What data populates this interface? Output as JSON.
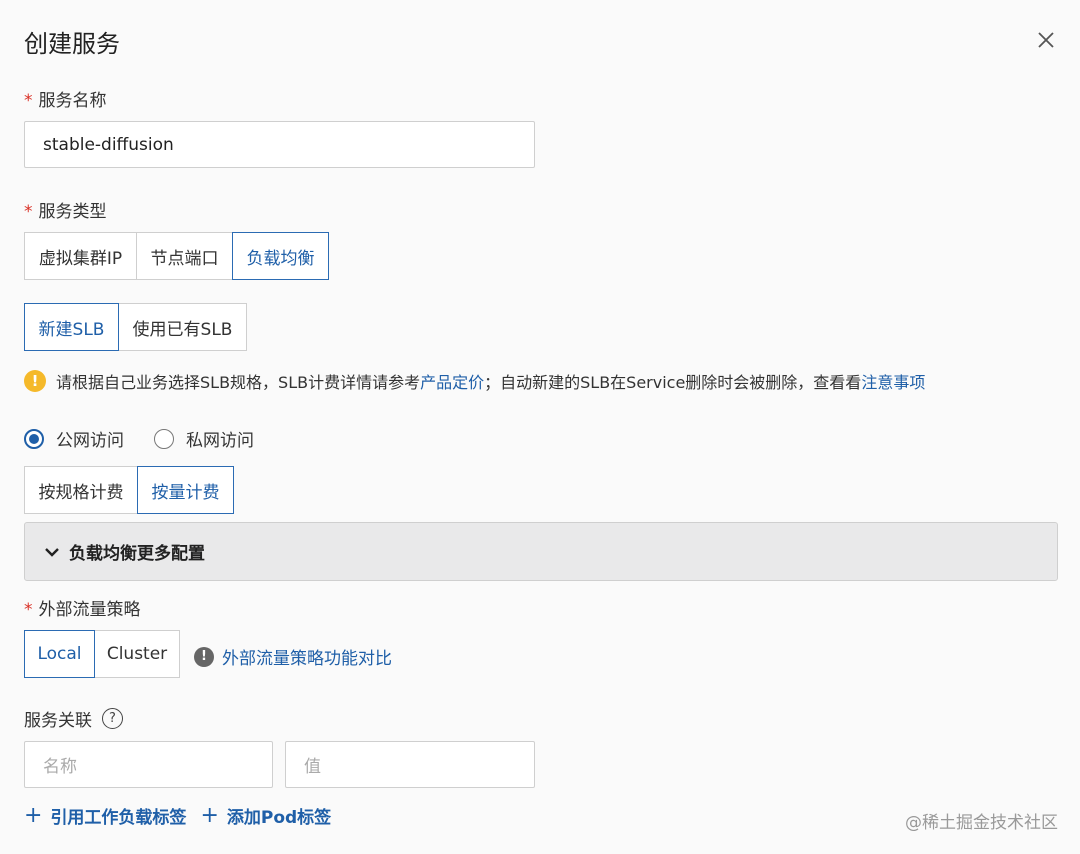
{
  "dialog": {
    "title": "创建服务",
    "close_icon": "close-icon"
  },
  "service_name": {
    "label": "服务名称",
    "required": "*",
    "value": "stable-diffusion"
  },
  "service_type": {
    "label": "服务类型",
    "required": "*",
    "options": [
      "虚拟集群IP",
      "节点端口",
      "负载均衡"
    ],
    "selected": "负载均衡"
  },
  "slb_mode": {
    "options": [
      "新建SLB",
      "使用已有SLB"
    ],
    "selected": "新建SLB"
  },
  "notice": {
    "icon": "warning-icon",
    "text_1": "请根据自己业务选择SLB规格，SLB计费详情请参考",
    "link_1": "产品定价",
    "text_2": "；自动新建的SLB在Service删除时会被删除，查看看",
    "link_2": "注意事项"
  },
  "access": {
    "options": [
      "公网访问",
      "私网访问"
    ],
    "selected": "公网访问"
  },
  "billing": {
    "options": [
      "按规格计费",
      "按量计费"
    ],
    "selected": "按量计费"
  },
  "more_config": {
    "label": "负载均衡更多配置",
    "icon": "chevron-down-icon"
  },
  "traffic_policy": {
    "label": "外部流量策略",
    "required": "*",
    "options": [
      "Local",
      "Cluster"
    ],
    "selected": "Local",
    "help_link": "外部流量策略功能对比",
    "help_icon": "info-icon"
  },
  "service_assoc": {
    "label": "服务关联",
    "help_icon": "question-icon",
    "name_placeholder": "名称",
    "value_placeholder": "值"
  },
  "add_links": {
    "workload": "引用工作负载标签",
    "pod": "添加Pod标签"
  },
  "watermark": "@稀土掘金技术社区",
  "colors": {
    "accent": "#1f5fa8",
    "required": "#d93026",
    "warning": "#f5b92a"
  }
}
